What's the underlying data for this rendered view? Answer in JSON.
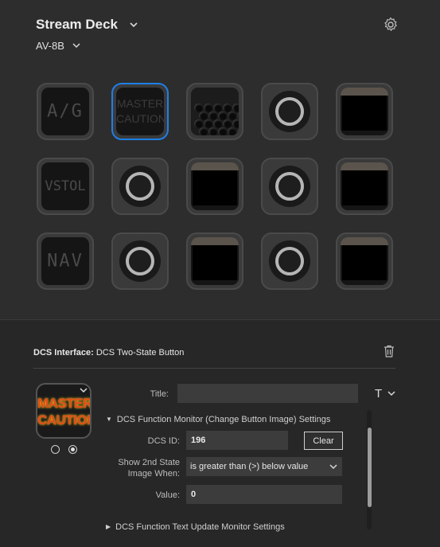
{
  "header": {
    "device_name": "Stream Deck",
    "profile_name": "AV-8B"
  },
  "keys": [
    {
      "row": 0,
      "col": 0,
      "type": "text",
      "text": "A/G",
      "selected": false
    },
    {
      "row": 0,
      "col": 1,
      "type": "text",
      "text": "MASTER CAUTION",
      "line1": "MASTER",
      "line2": "CAUTION",
      "selected": true
    },
    {
      "row": 0,
      "col": 2,
      "type": "grille",
      "selected": false
    },
    {
      "row": 0,
      "col": 3,
      "type": "ring",
      "selected": false
    },
    {
      "row": 0,
      "col": 4,
      "type": "screen",
      "selected": false
    },
    {
      "row": 1,
      "col": 0,
      "type": "text",
      "text": "VSTOL",
      "selected": false
    },
    {
      "row": 1,
      "col": 1,
      "type": "ring",
      "selected": false
    },
    {
      "row": 1,
      "col": 2,
      "type": "screen",
      "selected": false
    },
    {
      "row": 1,
      "col": 3,
      "type": "ring",
      "selected": false
    },
    {
      "row": 1,
      "col": 4,
      "type": "screen",
      "selected": false
    },
    {
      "row": 2,
      "col": 0,
      "type": "text",
      "text": "NAV",
      "selected": false
    },
    {
      "row": 2,
      "col": 1,
      "type": "ring",
      "selected": false
    },
    {
      "row": 2,
      "col": 2,
      "type": "screen",
      "selected": false
    },
    {
      "row": 2,
      "col": 3,
      "type": "ring",
      "selected": false
    },
    {
      "row": 2,
      "col": 4,
      "type": "screen",
      "selected": false
    }
  ],
  "inspector": {
    "plugin_name": "DCS Interface:",
    "action_name": "DCS Two-State Button",
    "preview": {
      "line1": "MASTER",
      "line2": "CAUTION"
    },
    "title_label": "Title:",
    "title_value": "",
    "title_format_glyph": "T",
    "section_function_monitor": "DCS Function Monitor (Change Button Image) Settings",
    "dcs_id_label": "DCS ID:",
    "dcs_id_value": "196",
    "clear_label": "Clear",
    "second_state_label_line1": "Show 2nd State",
    "second_state_label_line2": "Image When:",
    "second_state_value": "is greater than (>) below value",
    "value_label": "Value:",
    "value_value": "0",
    "section_text_update": "DCS Function Text Update Monitor Settings"
  },
  "colors": {
    "selection": "#1e7fe6",
    "preview_text": "#e04a1a",
    "preview_glow": "#ffd22a"
  }
}
